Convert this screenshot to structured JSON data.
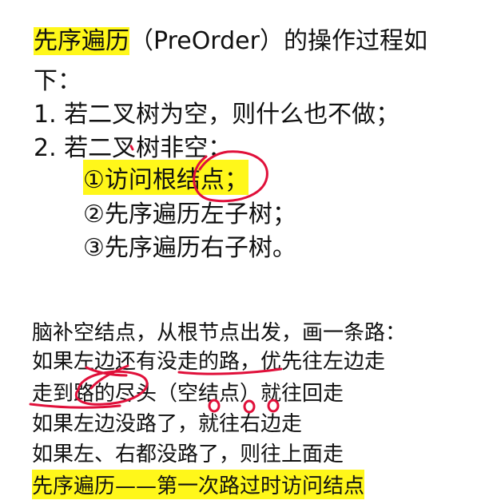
{
  "intro": {
    "highlight": "先序遍历",
    "rest": "（PreOrder）的操作过程如",
    "cont": "下："
  },
  "steps": [
    "1.  若二叉树为空，则什么也不做；",
    "2.  若二叉树非空："
  ],
  "sub_steps": [
    "①访问根结点；",
    "②先序遍历左子树；",
    "③先序遍历右子树。"
  ],
  "notes": [
    "脑补空结点，从根节点出发，画一条路：",
    "如果左边还有没走的路，优先往左边走",
    "走到路的尽头（空结点）就往回走",
    "如果左边没路了，就往右边走",
    "如果左、右都没路了，则往上面走"
  ],
  "summary": "先序遍历——第一次路过时访问结点",
  "colors": {
    "highlight": "#fff71a",
    "annotation_ink": "#e0103a"
  }
}
